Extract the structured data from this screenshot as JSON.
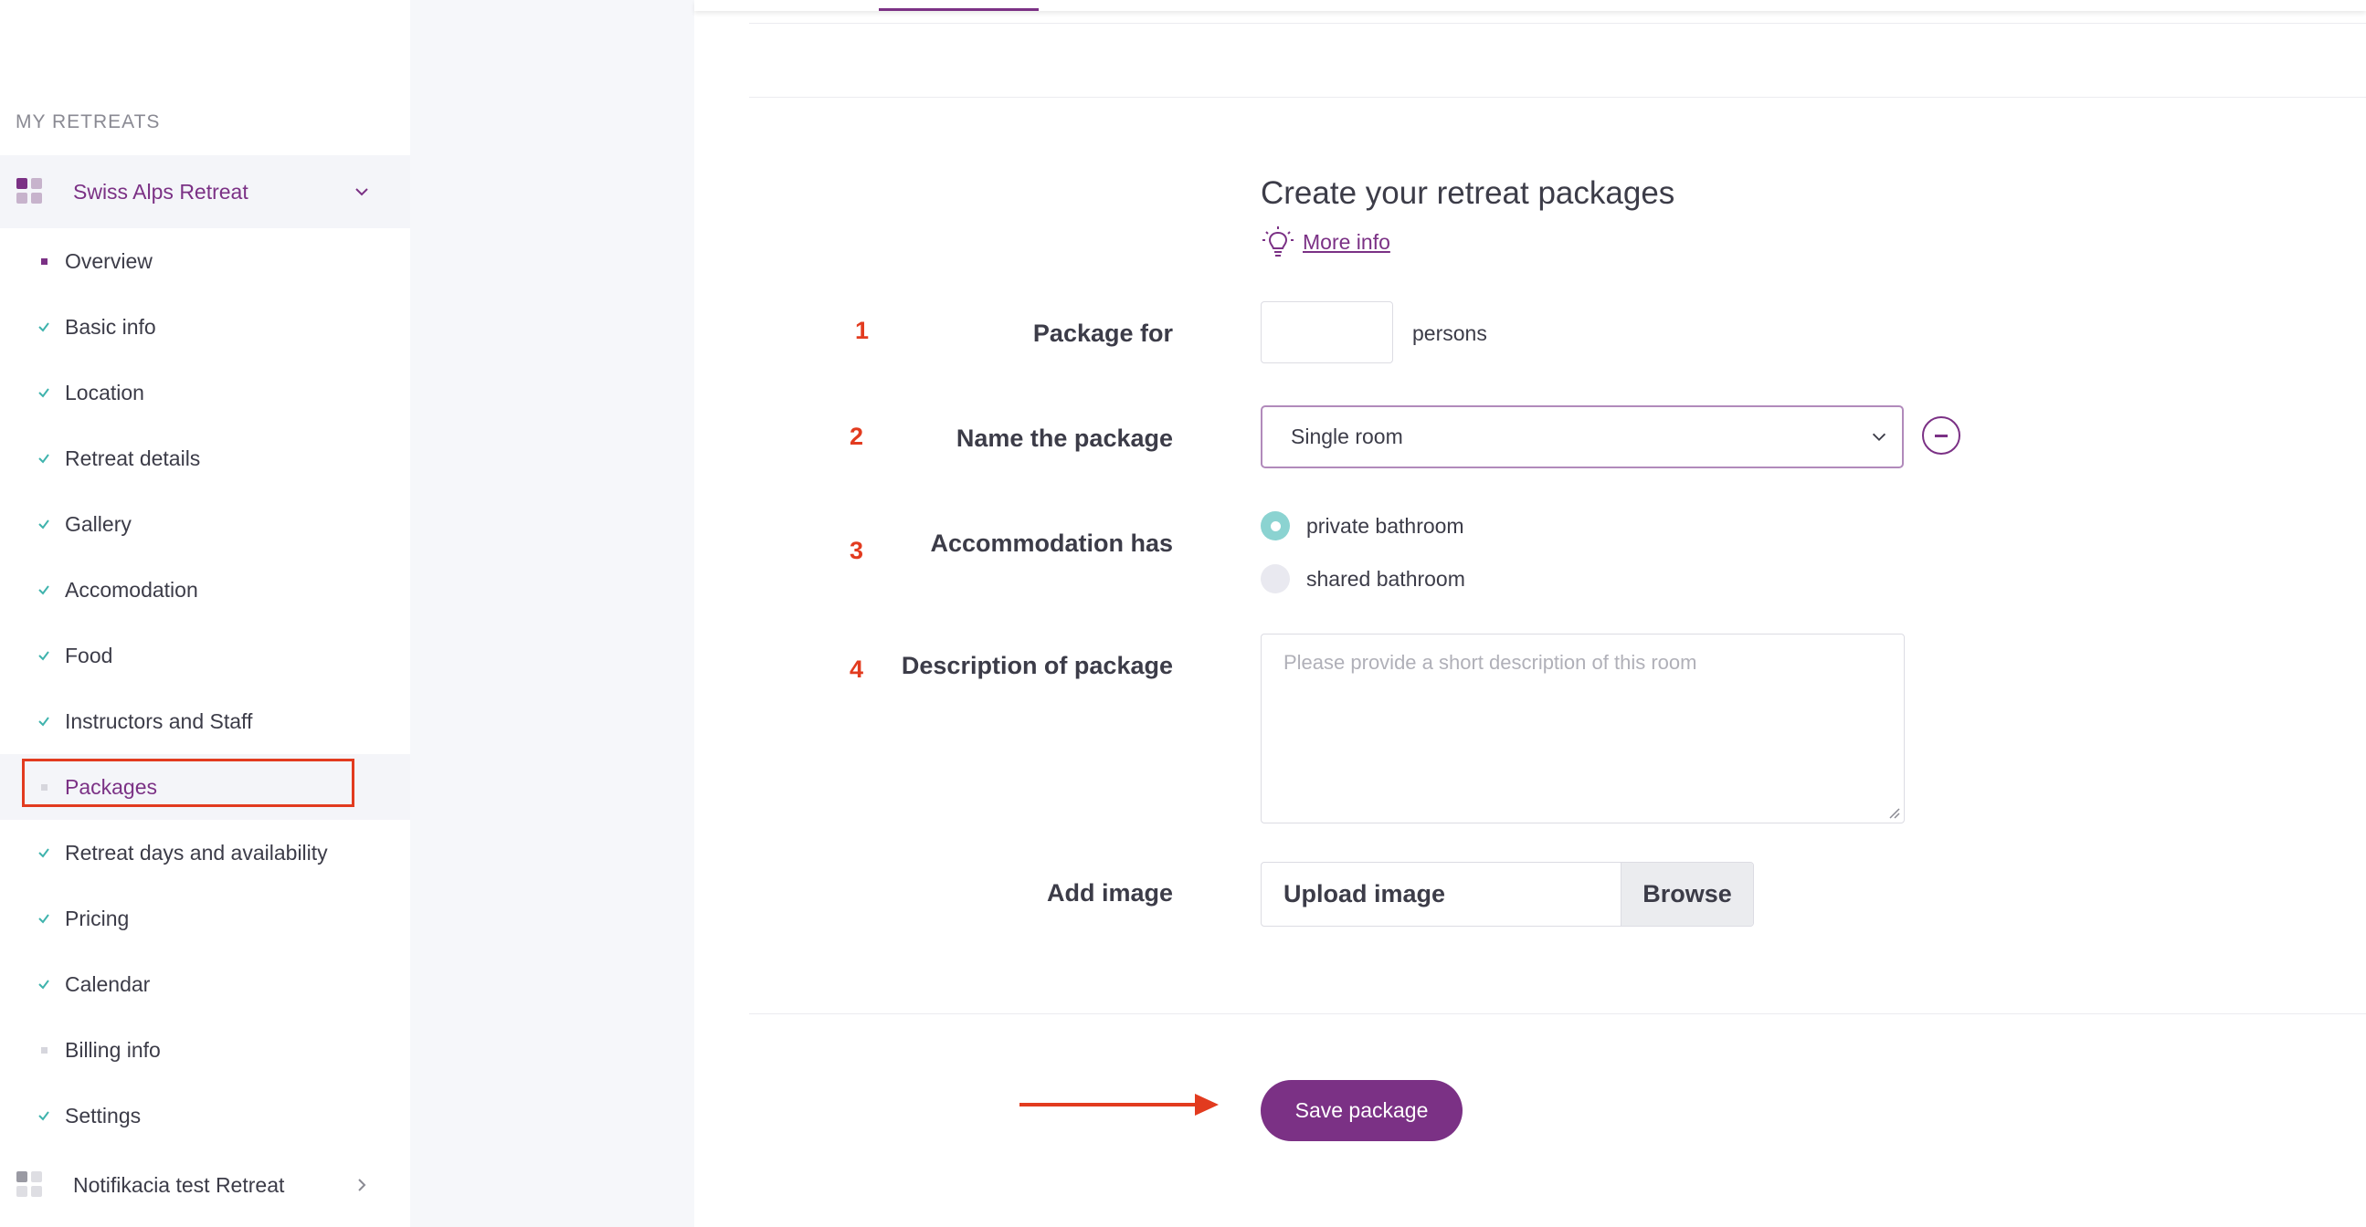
{
  "sidebar": {
    "section_title": "MY RETREATS",
    "active_retreat": {
      "name": "Swiss Alps Retreat",
      "icon": "chevron-down-icon"
    },
    "items": [
      {
        "label": "Overview",
        "state": "current-dot"
      },
      {
        "label": "Basic info",
        "state": "done"
      },
      {
        "label": "Location",
        "state": "done"
      },
      {
        "label": "Retreat details",
        "state": "done"
      },
      {
        "label": "Gallery",
        "state": "done"
      },
      {
        "label": "Accomodation",
        "state": "done"
      },
      {
        "label": "Food",
        "state": "done"
      },
      {
        "label": "Instructors and Staff",
        "state": "done"
      },
      {
        "label": "Packages",
        "state": "active"
      },
      {
        "label": "Retreat days and availability",
        "state": "done"
      },
      {
        "label": "Pricing",
        "state": "done"
      },
      {
        "label": "Calendar",
        "state": "done"
      },
      {
        "label": "Billing info",
        "state": "pending"
      },
      {
        "label": "Settings",
        "state": "done"
      }
    ],
    "other_retreat": {
      "name": "Notifikacia test Retreat",
      "icon": "chevron-right-icon"
    }
  },
  "main": {
    "title": "Create your retreat packages",
    "more_info": "More info",
    "steps": [
      "1",
      "2",
      "3",
      "4"
    ],
    "package_for": {
      "label": "Package for",
      "value": "",
      "unit": "persons"
    },
    "name_package": {
      "label": "Name the package",
      "selected": "Single room"
    },
    "accommodation": {
      "label": "Accommodation has",
      "options": [
        {
          "label": "private bathroom",
          "checked": true
        },
        {
          "label": "shared bathroom",
          "checked": false
        }
      ]
    },
    "description": {
      "label": "Description of package",
      "placeholder": "Please provide a short description of this room"
    },
    "add_image": {
      "label": "Add image",
      "placeholder": "Upload image",
      "browse": "Browse"
    },
    "save_label": "Save package"
  },
  "colors": {
    "accent": "#7b3185",
    "check": "#3fb3ad",
    "radio_on": "#8bd3d1",
    "annotation": "#e23b1f"
  }
}
